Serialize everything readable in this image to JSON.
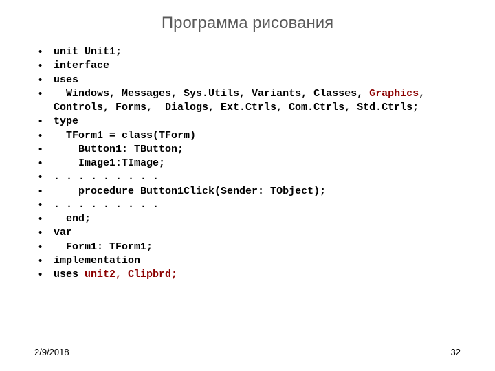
{
  "title": "Программа рисования",
  "lines": [
    {
      "type": "plain",
      "text": "unit Unit1;"
    },
    {
      "type": "plain",
      "text": "interface"
    },
    {
      "type": "plain",
      "text": "uses"
    },
    {
      "type": "highlight",
      "prefix": "  Windows, Messages, Sys.Utils, Variants, Classes, ",
      "highlight": "Graphics",
      "suffix": ", Controls, Forms,  Dialogs, Ext.Ctrls, Com.Ctrls, Std.Ctrls;"
    },
    {
      "type": "plain",
      "text": "type"
    },
    {
      "type": "plain",
      "text": "  TForm1 = class(TForm)"
    },
    {
      "type": "plain",
      "text": "    Button1: TButton;"
    },
    {
      "type": "plain",
      "text": "    Image1:TImage;"
    },
    {
      "type": "plain",
      "text": ". . . . . . . . ."
    },
    {
      "type": "plain",
      "text": "    procedure Button1Click(Sender: TObject);"
    },
    {
      "type": "plain",
      "text": ". . . . . . . . ."
    },
    {
      "type": "plain",
      "text": "  end;"
    },
    {
      "type": "plain",
      "text": "var"
    },
    {
      "type": "plain",
      "text": "  Form1: TForm1;"
    },
    {
      "type": "plain",
      "text": "implementation"
    },
    {
      "type": "highlight",
      "prefix": "uses ",
      "highlight": "unit2, Clipbrd;",
      "suffix": ""
    }
  ],
  "footer": {
    "date": "2/9/2018",
    "page": "32"
  }
}
